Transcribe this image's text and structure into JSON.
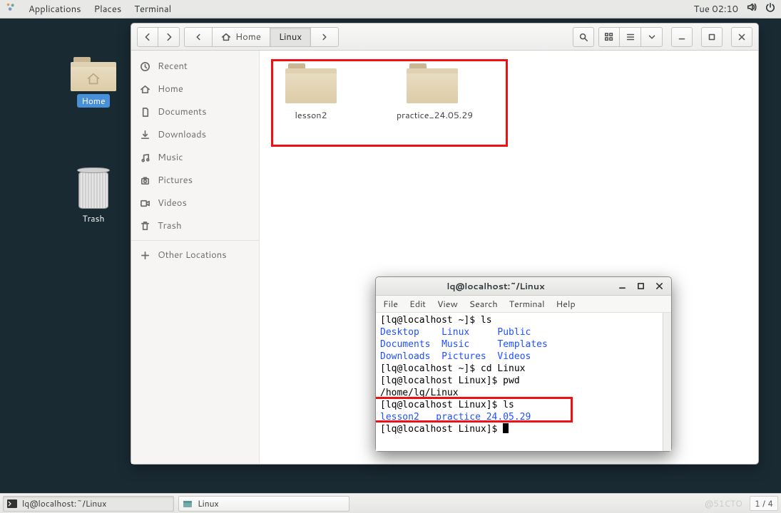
{
  "topbar": {
    "menus": [
      "Applications",
      "Places",
      "Terminal"
    ],
    "clock": "Tue 02:10"
  },
  "desktop": {
    "home_label": "Home",
    "trash_label": "Trash"
  },
  "filemanager": {
    "path": {
      "location1_label": "Home",
      "location2_label": "Linux"
    },
    "sidebar": {
      "items": [
        {
          "id": "recent",
          "label": "Recent"
        },
        {
          "id": "home",
          "label": "Home"
        },
        {
          "id": "documents",
          "label": "Documents"
        },
        {
          "id": "downloads",
          "label": "Downloads"
        },
        {
          "id": "music",
          "label": "Music"
        },
        {
          "id": "pictures",
          "label": "Pictures"
        },
        {
          "id": "videos",
          "label": "Videos"
        },
        {
          "id": "trash",
          "label": "Trash"
        }
      ],
      "other_label": "Other Locations"
    },
    "files": [
      {
        "name": "lesson2",
        "type": "folder"
      },
      {
        "name": "practice_24.05.29",
        "type": "folder"
      }
    ]
  },
  "terminal": {
    "title": "lq@localhost:~/Linux",
    "menus": [
      "File",
      "Edit",
      "View",
      "Search",
      "Terminal",
      "Help"
    ],
    "lines": [
      {
        "t": "prompt",
        "text": "[lq@localhost ~]$ ",
        "cmd": "ls"
      },
      {
        "t": "dirs",
        "cols": [
          "Desktop   ",
          "Linux    ",
          "Public"
        ]
      },
      {
        "t": "dirs",
        "cols": [
          "Documents ",
          "Music    ",
          "Templates"
        ]
      },
      {
        "t": "dirs",
        "cols": [
          "Downloads ",
          "Pictures ",
          "Videos"
        ]
      },
      {
        "t": "prompt",
        "text": "[lq@localhost ~]$ ",
        "cmd": "cd Linux"
      },
      {
        "t": "prompt",
        "text": "[lq@localhost Linux]$ ",
        "cmd": "pwd"
      },
      {
        "t": "plain",
        "text": "/home/lq/Linux"
      },
      {
        "t": "prompt",
        "text": "[lq@localhost Linux]$ ",
        "cmd": "ls"
      },
      {
        "t": "dirs",
        "cols": [
          "lesson2  ",
          "practice_24.05.29"
        ]
      },
      {
        "t": "prompt",
        "text": "[lq@localhost Linux]$ ",
        "cmd": "",
        "cursor": true
      }
    ]
  },
  "taskbar": {
    "items": [
      {
        "icon": "terminal",
        "label": "lq@localhost:~/Linux",
        "active": true
      },
      {
        "icon": "files",
        "label": "Linux",
        "active": false
      }
    ],
    "pager": "1 / 4",
    "watermark": "@51CTO"
  }
}
